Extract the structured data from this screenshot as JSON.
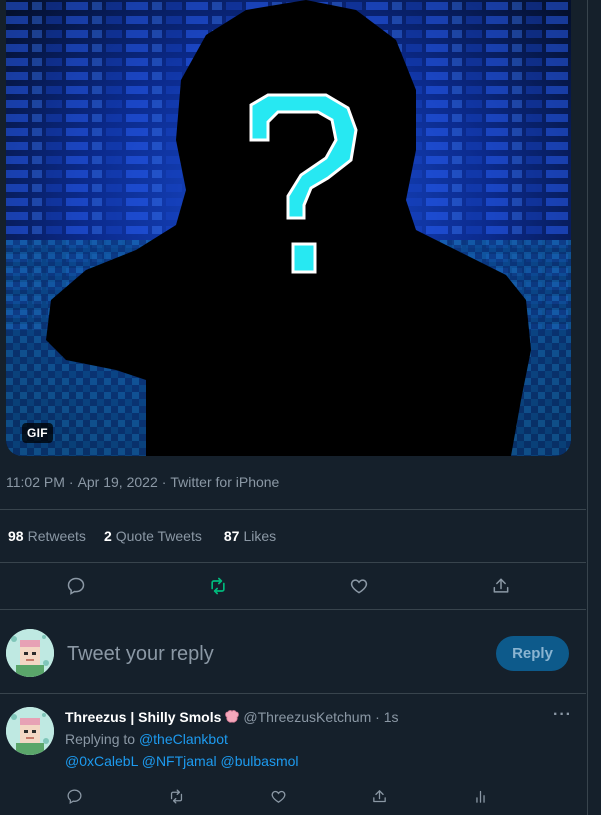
{
  "media": {
    "badge": "GIF"
  },
  "tweet_meta": {
    "time": "11:02 PM",
    "date": "Apr 19, 2022",
    "source": "Twitter for iPhone",
    "separator": "·"
  },
  "stats": {
    "retweets_count": "98",
    "retweets_label": "Retweets",
    "quotes_count": "2",
    "quotes_label": "Quote Tweets",
    "likes_count": "87",
    "likes_label": "Likes"
  },
  "composer": {
    "placeholder": "Tweet your reply",
    "button_label": "Reply"
  },
  "reply_tweet": {
    "display_name": "Threezus | Shilly Smols",
    "handle": "@ThreezusKetchum",
    "age": "1s",
    "separator": "·",
    "replying_prefix": "Replying to",
    "replying_to": "@theClankbot",
    "mentions": "@0xCalebL @NFTjamal @bulbasmol",
    "more": "···"
  },
  "colors": {
    "background": "#15202b",
    "accent": "#1d9bf0",
    "retweet_active": "#00ba7c",
    "secondary_text": "#8b98a5",
    "question_mark": "#27e8f2"
  },
  "icons": [
    "reply-icon",
    "retweet-icon",
    "like-icon",
    "share-icon",
    "analytics-icon",
    "more-icon",
    "brain-emoji"
  ]
}
